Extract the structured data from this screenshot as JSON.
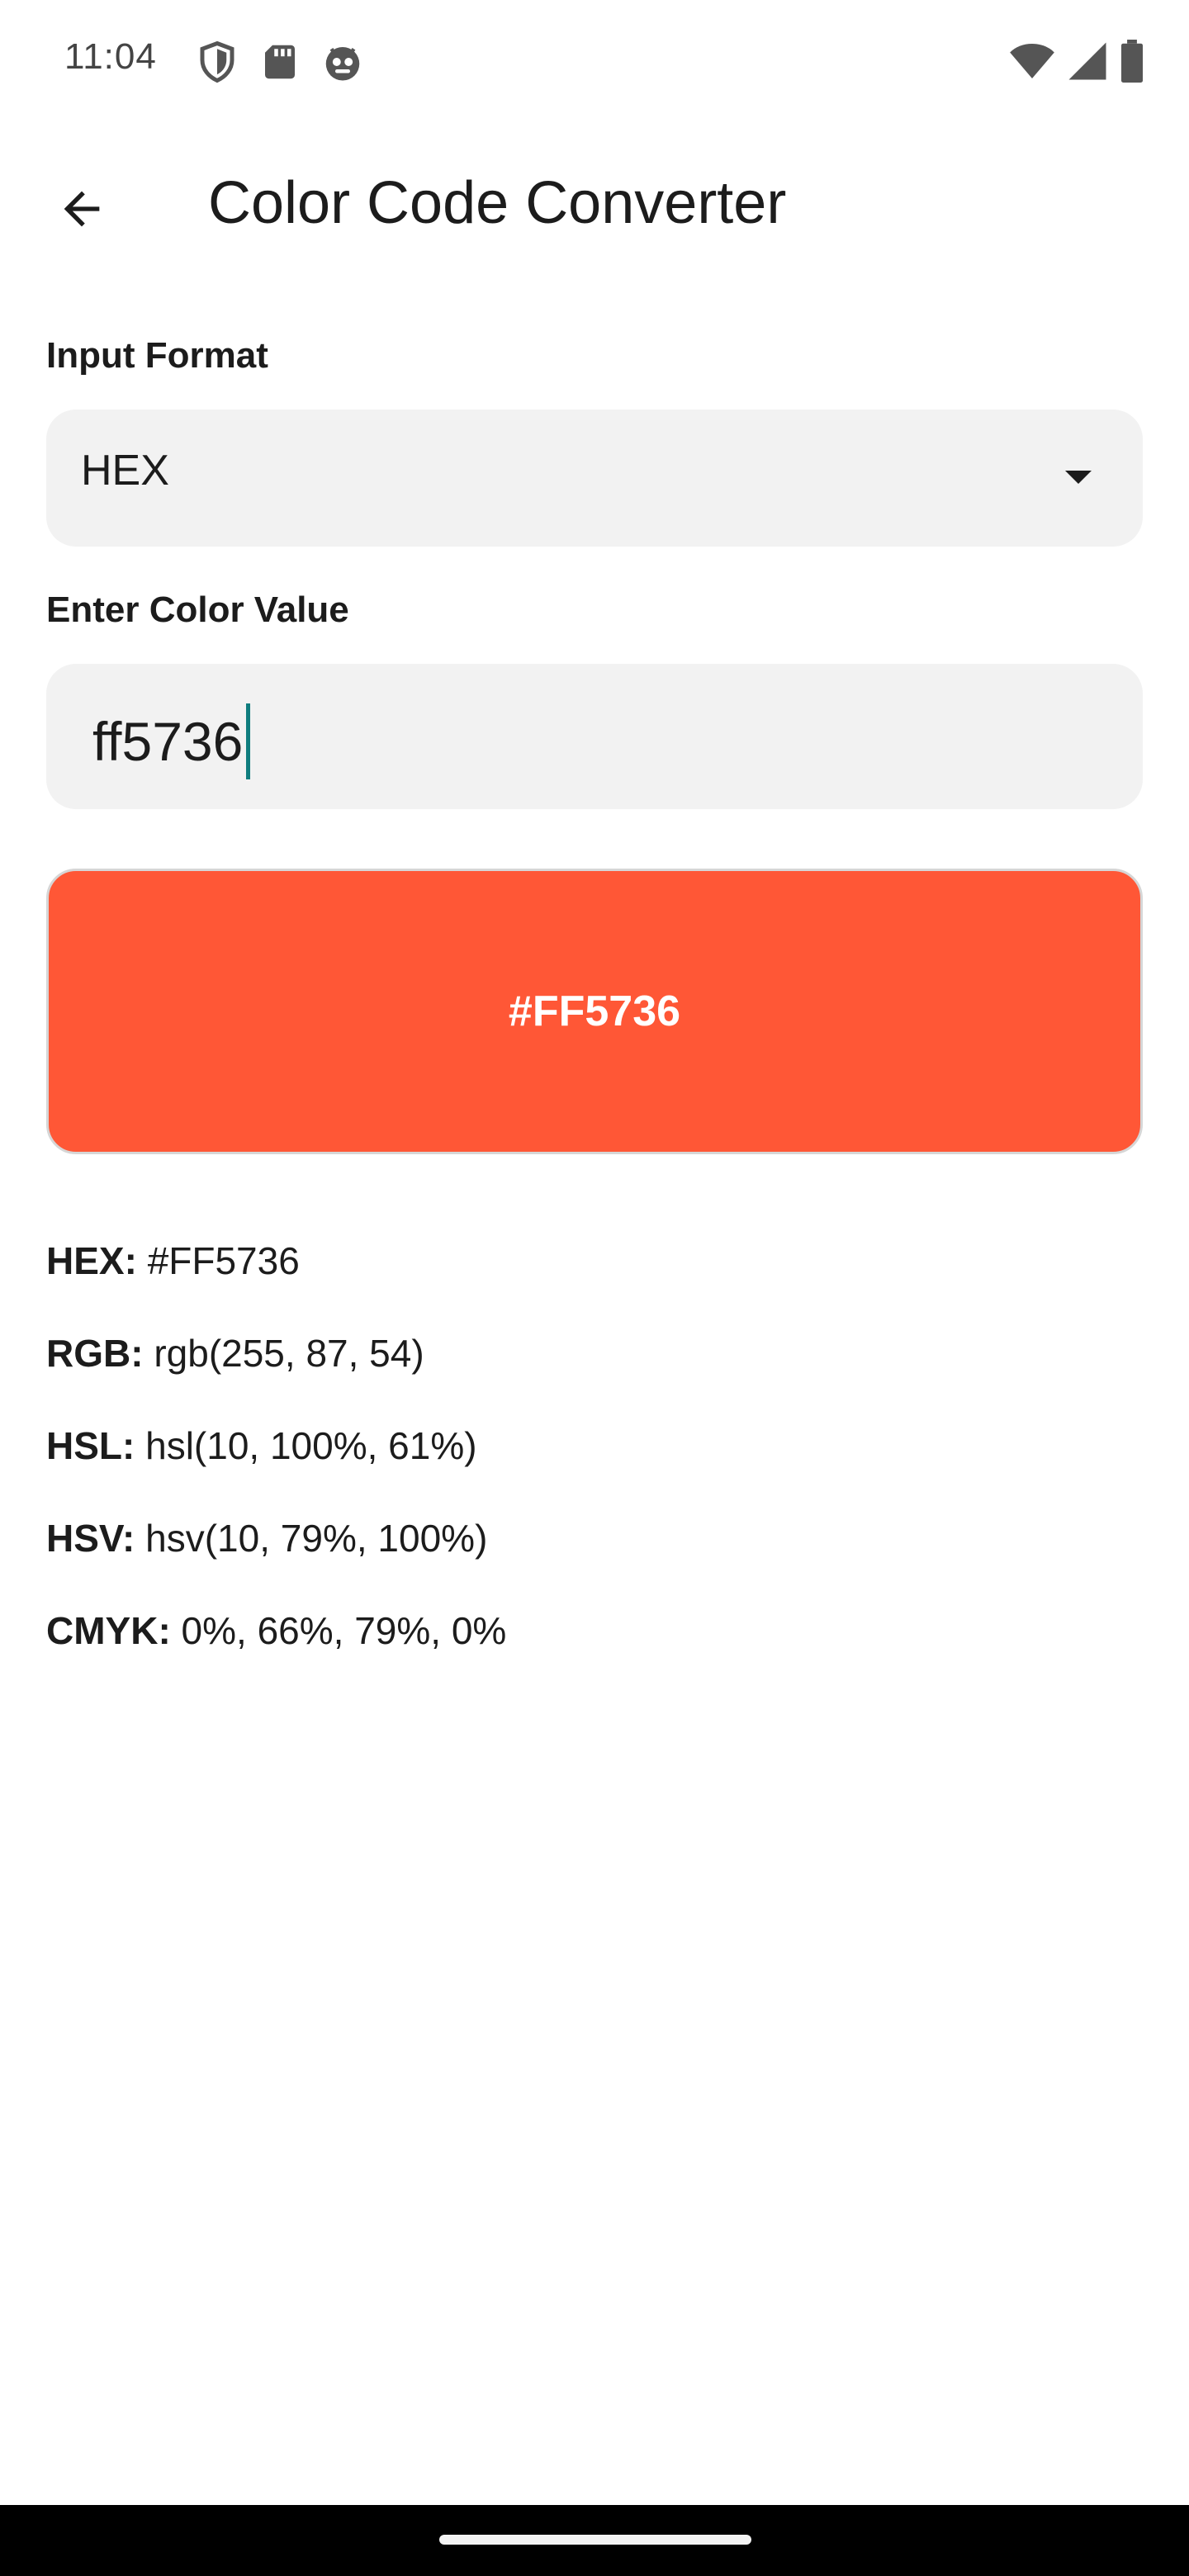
{
  "status_bar": {
    "time": "11:04",
    "left_icons": [
      "shield-icon",
      "sd-card-icon",
      "robot-face-icon"
    ],
    "right_icons": [
      "wifi-icon",
      "cell-signal-icon",
      "battery-icon"
    ]
  },
  "app_bar": {
    "back_icon": "arrow-back-icon",
    "title": "Color Code Converter"
  },
  "input_format": {
    "label": "Input Format",
    "selected": "HEX",
    "caret_icon": "dropdown-arrow-icon"
  },
  "color_value": {
    "label": "Enter Color Value",
    "value": "ff5736"
  },
  "preview": {
    "color": "#FF5736",
    "text": "#FF5736"
  },
  "results": [
    {
      "key": "HEX:",
      "value": "#FF5736"
    },
    {
      "key": "RGB:",
      "value": "rgb(255, 87, 54)"
    },
    {
      "key": "HSL:",
      "value": "hsl(10, 100%, 61%)"
    },
    {
      "key": "HSV:",
      "value": "hsv(10, 79%, 100%)"
    },
    {
      "key": "CMYK:",
      "value": "0%, 66%, 79%, 0%"
    }
  ],
  "colors": {
    "accent_cursor": "#0F7D7E",
    "field_background": "#F2F2F2",
    "preview_swatch": "#FF5736"
  }
}
